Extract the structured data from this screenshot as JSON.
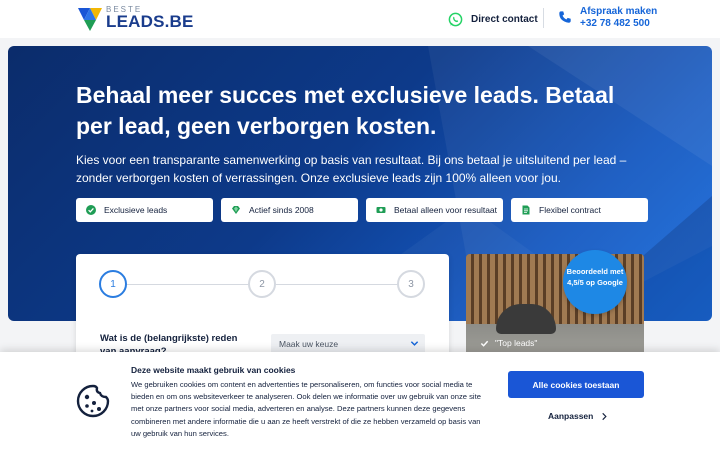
{
  "header": {
    "logo": {
      "top": "BESTE",
      "bottom": "LEADS.BE"
    },
    "direct_contact": "Direct contact",
    "appointment": "Afspraak maken",
    "phone": "+32 78 482 500"
  },
  "hero": {
    "title": "Behaal meer succes met exclusieve leads. Betaal per lead, geen verborgen kosten.",
    "subtitle": "Kies voor een transparante samenwerking op basis van resultaat. Bij ons betaal je uitsluitend per lead – zonder verborgen kosten of verrassingen. Onze exclusieve leads zijn 100% alleen voor jou.",
    "features": [
      {
        "label": "Exclusieve leads",
        "icon": "check-circle-icon"
      },
      {
        "label": "Actief sinds 2008",
        "icon": "diamond-icon"
      },
      {
        "label": "Betaal alleen voor resultaat",
        "icon": "money-icon"
      },
      {
        "label": "Flexibel contract",
        "icon": "document-icon"
      }
    ]
  },
  "form": {
    "steps": [
      "1",
      "2",
      "3"
    ],
    "active_step": 1,
    "question": "Wat is de (belangrijkste) reden van aanvraag?",
    "select_value": "Maak uw keuze"
  },
  "photo": {
    "caption": "\"Top leads\"",
    "rating_badge": "Beoordeeld met 4,5/5 op Google"
  },
  "cookie": {
    "title": "Deze website maakt gebruik van cookies",
    "body": "We gebruiken cookies om content en advertenties te personaliseren, om functies voor social media te bieden en om ons websiteverkeer te analyseren. Ook delen we informatie over uw gebruik van onze site met onze partners voor social media, adverteren en analyse. Deze partners kunnen deze gegevens combineren met andere informatie die u aan ze heeft verstrekt of die ze hebben verzameld op basis van uw gebruik van hun services.",
    "accept_label": "Alle cookies toestaan",
    "customize_label": "Aanpassen"
  },
  "colors": {
    "brand_blue": "#1a3c8c",
    "accent_blue": "#1a56d6",
    "whatsapp_green": "#25d366",
    "feature_green": "#1f9d55"
  }
}
